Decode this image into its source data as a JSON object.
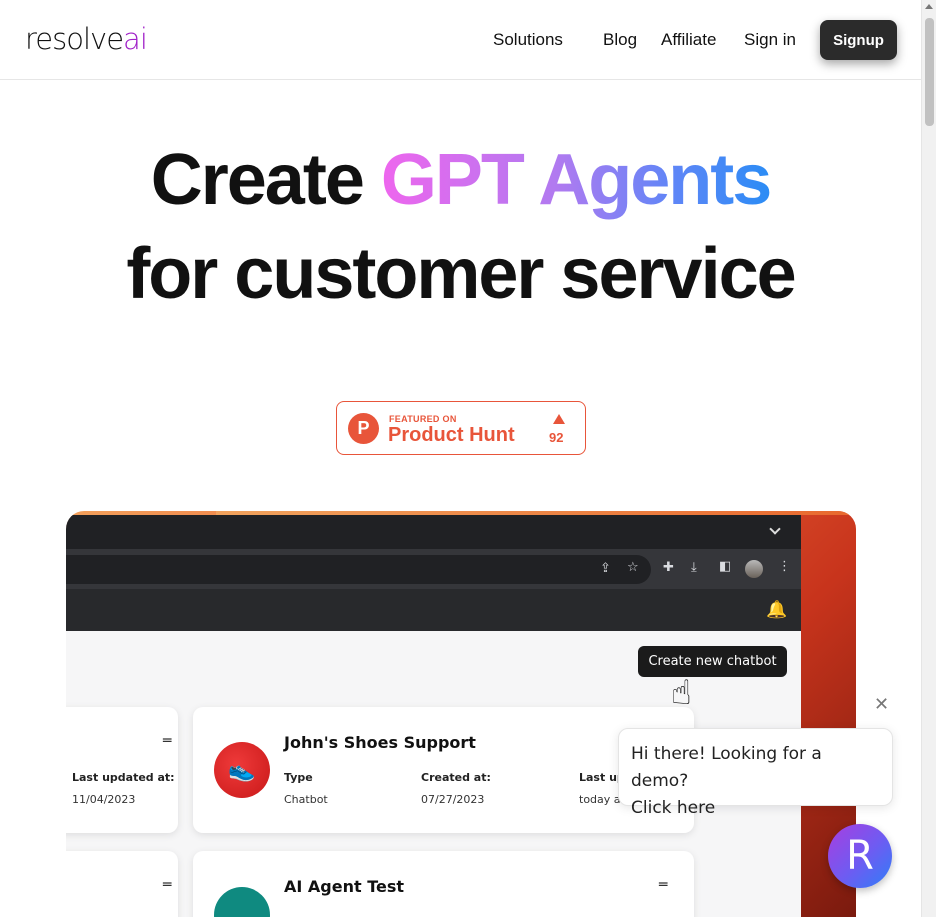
{
  "nav": {
    "logo_main": "resolve",
    "logo_accent": "ai",
    "links": [
      "Solutions",
      "Blog",
      "Affiliate",
      "Sign in"
    ],
    "signup": "Signup"
  },
  "hero": {
    "line1_plain": "Create ",
    "line1_gradient": "GPT Agents",
    "line2": "for customer service"
  },
  "product_hunt": {
    "logo_letter": "P",
    "featured_on": "FEATURED ON",
    "name": "Product Hunt",
    "upvotes": "92"
  },
  "mockup": {
    "create_button": "Create new chatbot",
    "left_card": {
      "last_updated_label": "Last updated at:",
      "last_updated_value": "11/04/2023"
    },
    "cards": [
      {
        "title": "John's Shoes Support",
        "type_label": "Type",
        "type_value": "Chatbot",
        "created_label": "Created at:",
        "created_value": "07/27/2023",
        "updated_label": "Last up",
        "updated_value": "today at"
      },
      {
        "title": "AI Agent Test"
      }
    ]
  },
  "chat": {
    "message_line1": "Hi there! Looking for a demo?",
    "message_line2": "Click here",
    "avatar_letter": "R"
  },
  "colors": {
    "accent_purple": "#a020c8",
    "product_hunt": "#e8553a",
    "signup_bg": "#2b2b2b"
  }
}
